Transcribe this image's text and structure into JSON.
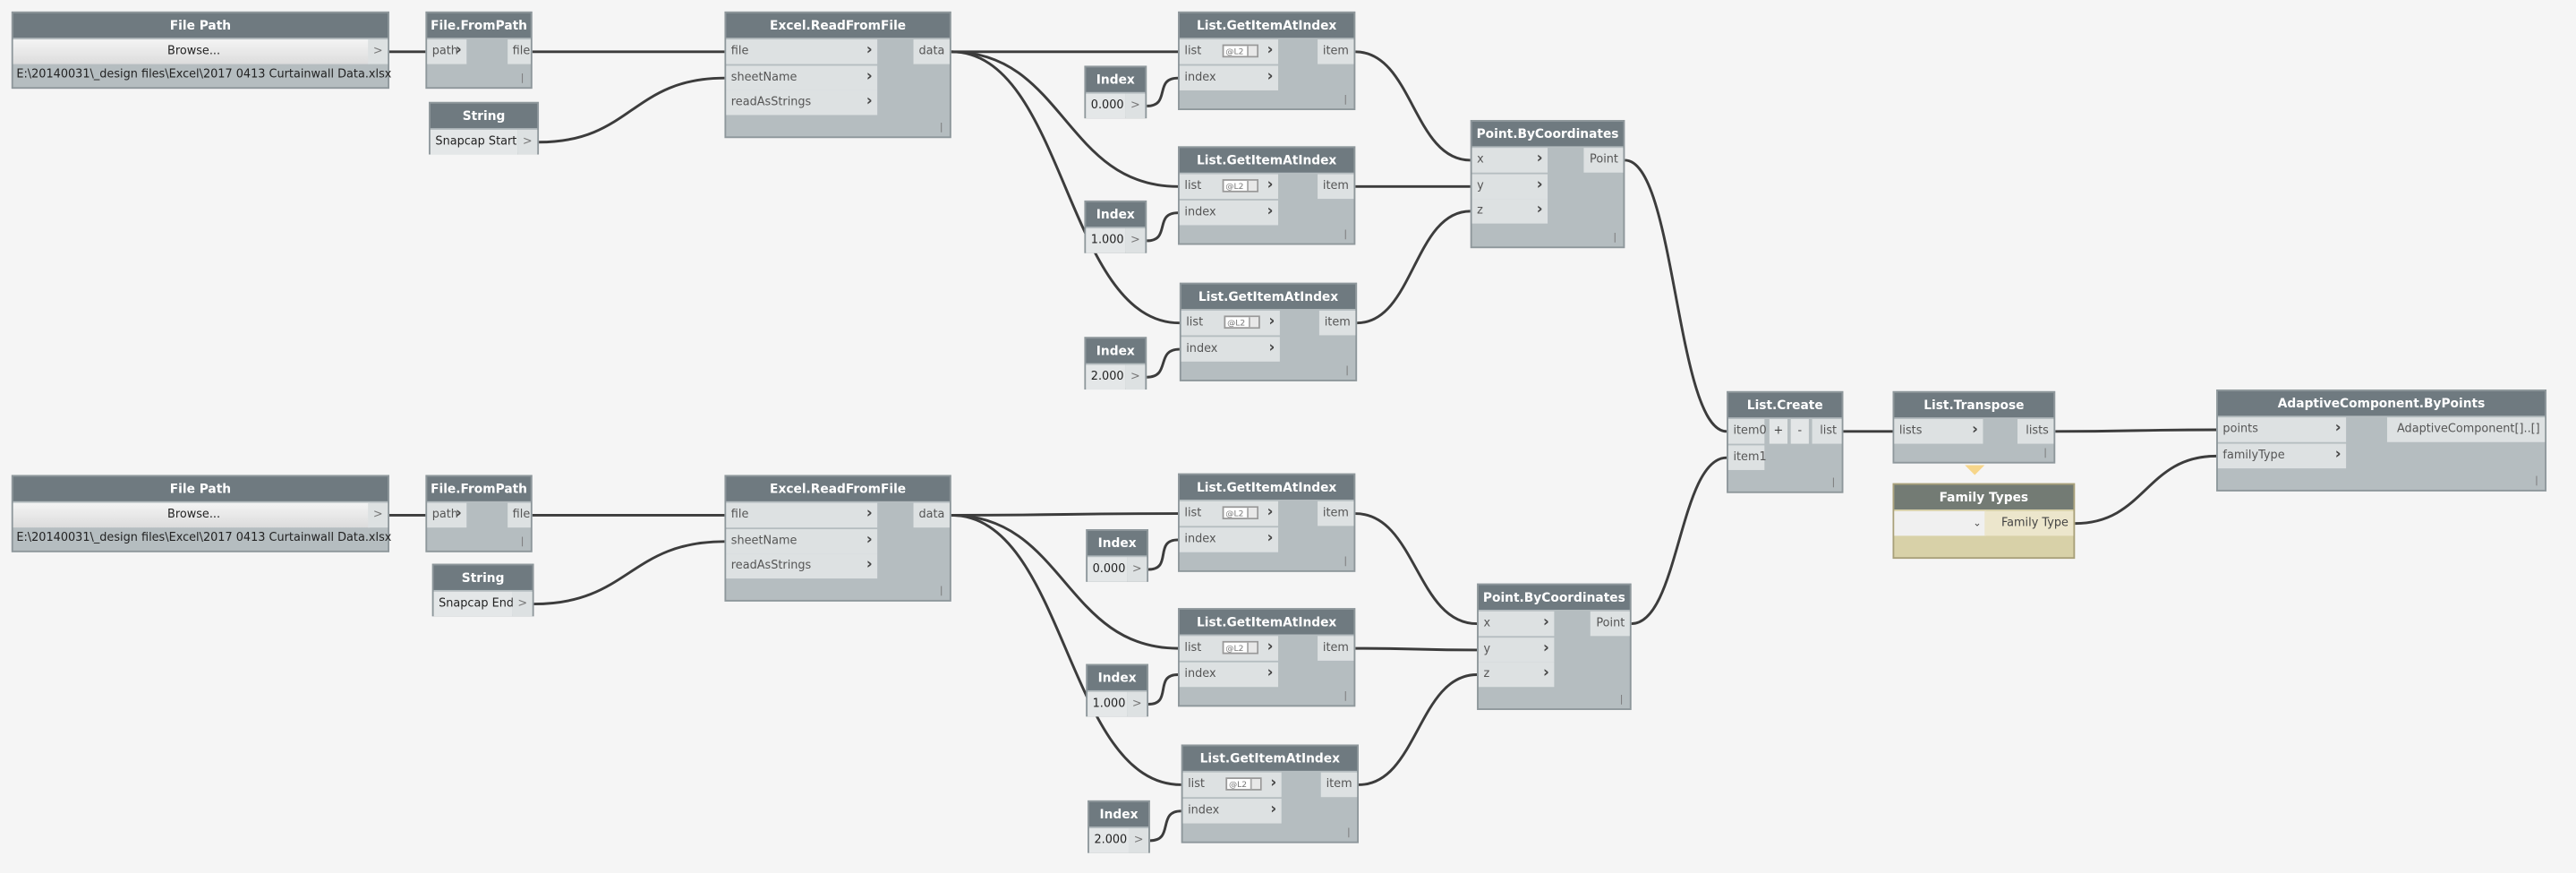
{
  "colors": {
    "background": "#f5f5f5",
    "node_header": "#6f7a80",
    "node_body": "#b5bdc0",
    "port": "#dde1e2",
    "wire": "#3c3c3c",
    "family_types_body": "#d8d1a8"
  },
  "icons": {
    "input_chevron": "chevron-right-icon",
    "output_arrow": "greater-than-icon",
    "dropdown": "chevron-down-icon"
  },
  "nodes": {
    "fp1": {
      "title": "File Path",
      "button": "Browse...",
      "out": ">",
      "value": "E:\\20140031\\_design files\\Excel\\2017 0413 Curtainwall Data.xlsx"
    },
    "ffp1": {
      "title": "File.FromPath",
      "inputs": [
        "path"
      ],
      "outputs": [
        "file"
      ]
    },
    "str1": {
      "title": "String",
      "value": "Snapcap Start",
      "out": ">"
    },
    "er1": {
      "title": "Excel.ReadFromFile",
      "inputs": [
        "file",
        "sheetName",
        "readAsStrings"
      ],
      "outputs": [
        "data"
      ]
    },
    "idx1": {
      "title": "Index",
      "value": "0.000",
      "out": ">"
    },
    "idx2": {
      "title": "Index",
      "value": "1.000",
      "out": ">"
    },
    "idx3": {
      "title": "Index",
      "value": "2.000",
      "out": ">"
    },
    "gi1": {
      "title": "List.GetItemAtIndex",
      "inputs": [
        "list",
        "index"
      ],
      "outputs": [
        "item"
      ],
      "lacing": "@L2"
    },
    "gi2": {
      "title": "List.GetItemAtIndex",
      "inputs": [
        "list",
        "index"
      ],
      "outputs": [
        "item"
      ],
      "lacing": "@L2"
    },
    "gi3": {
      "title": "List.GetItemAtIndex",
      "inputs": [
        "list",
        "index"
      ],
      "outputs": [
        "item"
      ],
      "lacing": "@L2"
    },
    "pt1": {
      "title": "Point.ByCoordinates",
      "inputs": [
        "x",
        "y",
        "z"
      ],
      "outputs": [
        "Point"
      ]
    },
    "fp2": {
      "title": "File Path",
      "button": "Browse...",
      "out": ">",
      "value": "E:\\20140031\\_design files\\Excel\\2017 0413 Curtainwall Data.xlsx"
    },
    "ffp2": {
      "title": "File.FromPath",
      "inputs": [
        "path"
      ],
      "outputs": [
        "file"
      ]
    },
    "str2": {
      "title": "String",
      "value": "Snapcap End",
      "out": ">"
    },
    "er2": {
      "title": "Excel.ReadFromFile",
      "inputs": [
        "file",
        "sheetName",
        "readAsStrings"
      ],
      "outputs": [
        "data"
      ]
    },
    "idx4": {
      "title": "Index",
      "value": "0.000",
      "out": ">"
    },
    "idx5": {
      "title": "Index",
      "value": "1.000",
      "out": ">"
    },
    "idx6": {
      "title": "Index",
      "value": "2.000",
      "out": ">"
    },
    "gi4": {
      "title": "List.GetItemAtIndex",
      "inputs": [
        "list",
        "index"
      ],
      "outputs": [
        "item"
      ],
      "lacing": "@L2"
    },
    "gi5": {
      "title": "List.GetItemAtIndex",
      "inputs": [
        "list",
        "index"
      ],
      "outputs": [
        "item"
      ],
      "lacing": "@L2"
    },
    "gi6": {
      "title": "List.GetItemAtIndex",
      "inputs": [
        "list",
        "index"
      ],
      "outputs": [
        "item"
      ],
      "lacing": "@L2"
    },
    "pt2": {
      "title": "Point.ByCoordinates",
      "inputs": [
        "x",
        "y",
        "z"
      ],
      "outputs": [
        "Point"
      ]
    },
    "lc": {
      "title": "List.Create",
      "inputs": [
        "item0",
        "item1"
      ],
      "outputs": [
        "list"
      ],
      "add": "+",
      "remove": "-"
    },
    "lt": {
      "title": "List.Transpose",
      "inputs": [
        "lists"
      ],
      "outputs": [
        "lists"
      ]
    },
    "ft": {
      "title": "Family Types",
      "selected": "",
      "outputs": [
        "Family Type"
      ]
    },
    "ac": {
      "title": "AdaptiveComponent.ByPoints",
      "inputs": [
        "points",
        "familyType"
      ],
      "outputs": [
        "AdaptiveComponent[]..[]"
      ]
    }
  }
}
